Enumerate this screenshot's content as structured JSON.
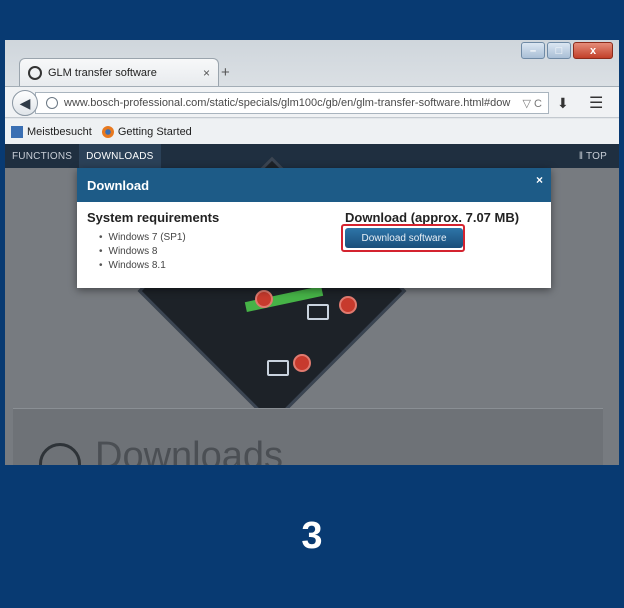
{
  "browser": {
    "tab_title": "GLM transfer software",
    "tab_close": "×",
    "new_tab": "+",
    "url": "www.bosch-professional.com/static/specials/glm100c/gb/en/glm-transfer-software.html#dow",
    "url_tools": "▽ C",
    "window_buttons": {
      "minimize": "–",
      "maximize": "□",
      "close": "x"
    },
    "bookmarks": [
      {
        "label": "Meistbesucht",
        "icon": "bookmark-folder-icon"
      },
      {
        "label": "Getting Started",
        "icon": "firefox-icon"
      }
    ]
  },
  "site": {
    "nav": [
      {
        "label": "FUNCTIONS"
      },
      {
        "label": "DOWNLOADS"
      }
    ],
    "top_link": "‖ TOP",
    "section_heading": "Downloads"
  },
  "modal": {
    "title": "Download",
    "close": "×",
    "requirements_title": "System requirements",
    "requirements": [
      "Windows 7 (SP1)",
      "Windows 8",
      "Windows 8.1"
    ],
    "download_title": "Download (approx. 7.07 MB)",
    "download_button": "Download software"
  },
  "step_number": "3",
  "colors": {
    "background": "#083a72",
    "modal_header": "#1d5b87",
    "highlight": "#d4232f",
    "site_nav": "#1f2f40"
  }
}
